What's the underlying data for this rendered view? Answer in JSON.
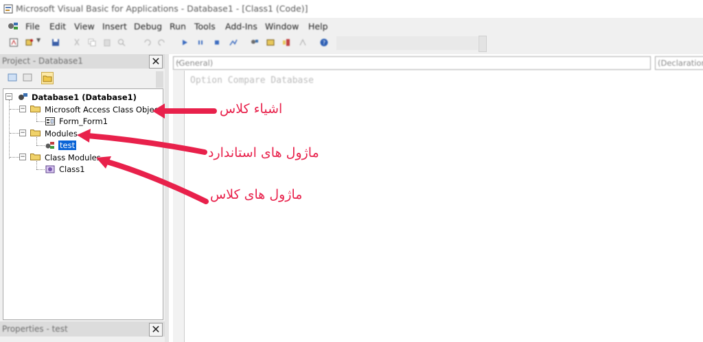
{
  "window": {
    "title": "Microsoft Visual Basic for Applications - Database1 - [Class1 (Code)]"
  },
  "menu": [
    "File",
    "Edit",
    "View",
    "Insert",
    "Debug",
    "Run",
    "Tools",
    "Add-Ins",
    "Window",
    "Help"
  ],
  "project": {
    "title": "Project - Database1",
    "tree": {
      "root": "Database1 (Database1)",
      "group1": "Microsoft Access Class Objects",
      "form": "Form_Form1",
      "group2": "Modules",
      "module": "test",
      "group3": "Class Modules",
      "classmodule": "Class1"
    }
  },
  "properties": {
    "title": "Properties - test"
  },
  "code": {
    "object_combo": "(General)",
    "procedure_combo": "(Declarations)",
    "line1": "Option Compare Database"
  },
  "annotations": {
    "class_objects": "اشیاء کلاس",
    "standard_modules": "ماژول های استاندارد",
    "class_modules": "ماژول های کلاس"
  },
  "colors": {
    "annotation": "#e8214b",
    "selection": "#0a64d6"
  }
}
